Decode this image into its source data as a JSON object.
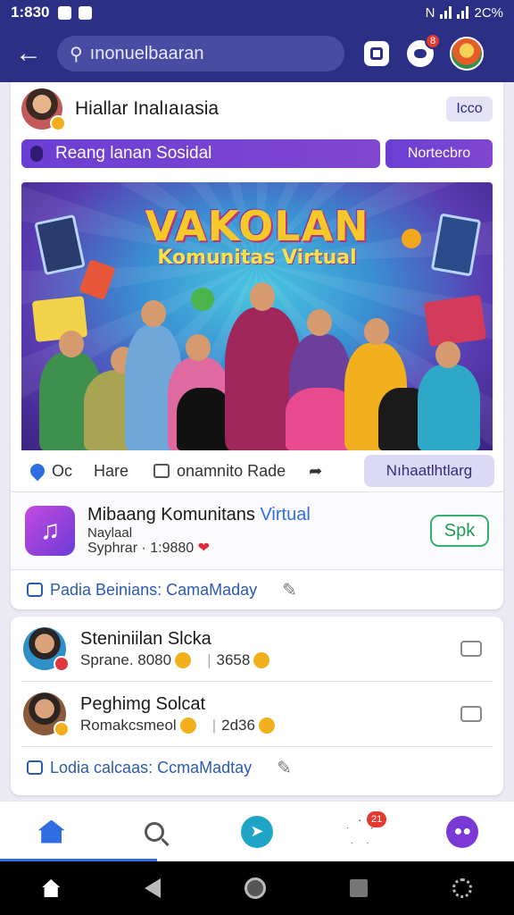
{
  "status": {
    "time": "1:830",
    "battery": "2C%"
  },
  "search": {
    "placeholder": "ınonuelbaaran"
  },
  "header": {
    "chat_badge": "8"
  },
  "post": {
    "author": "Hiallar Inalıaıasia",
    "more_label": "Icco",
    "tag_main": "Reang lanan Sosidal",
    "tag_side": "Nortecbro",
    "banner_title": "VAKOLAN",
    "banner_subtitle": "Komunitas Virtual",
    "actions": {
      "like": "Oc",
      "share_text": "Hare",
      "comment": "onamnito Rade",
      "share_btn": "Nıhaatlhtlarg"
    }
  },
  "app": {
    "title": "Mibaang Komunitans",
    "title_accent": "Virtual",
    "subtitle": "Naylaal",
    "meta": "Syphrar · 1:9880",
    "button": "Spk"
  },
  "footer1": "Padia Beinians: CamaMaday",
  "comments": [
    {
      "name": "Steniniilan Slcka",
      "meta_left": "Sprane. 8080",
      "meta_right": "3658"
    },
    {
      "name": "Peghimg Solcat",
      "meta_left": "Romakcsmeol",
      "meta_right": "2d36"
    }
  ],
  "footer2": "Lodia calcaas: CcmaMadtay",
  "nav": {
    "notif_badge": "21"
  },
  "colors": {
    "brand": "#2b2f86",
    "accent": "#2f6ee0",
    "tag": "#7442d1",
    "success": "#1e9a55"
  }
}
